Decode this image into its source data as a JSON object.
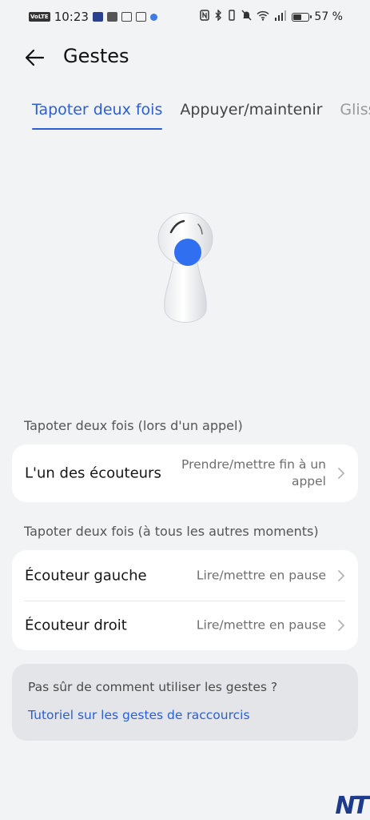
{
  "status_bar": {
    "time": "10:23",
    "volte": "VoLTE",
    "battery_percent": "57 %",
    "battery_level": 0.57
  },
  "header": {
    "title": "Gestes"
  },
  "tabs": [
    {
      "label": "Tapoter deux fois",
      "active": true
    },
    {
      "label": "Appuyer/maintenir",
      "active": false
    },
    {
      "label": "Glisser",
      "active": false
    }
  ],
  "section_call": {
    "title": "Tapoter deux fois (lors d'un appel)",
    "rows": [
      {
        "label": "L'un des écouteurs",
        "value": "Prendre/mettre fin à un appel"
      }
    ]
  },
  "section_other": {
    "title": "Tapoter deux fois (à tous les autres moments)",
    "rows": [
      {
        "label": "Écouteur gauche",
        "value": "Lire/mettre en pause"
      },
      {
        "label": "Écouteur droit",
        "value": "Lire/mettre en pause"
      }
    ]
  },
  "help": {
    "question": "Pas sûr de comment utiliser les gestes ?",
    "link": "Tutoriel sur les gestes de raccourcis"
  },
  "watermark": "NT",
  "colors": {
    "accent": "#2a5fd6",
    "tap_dot": "#2f6ff0",
    "background": "#f1f3f5"
  }
}
